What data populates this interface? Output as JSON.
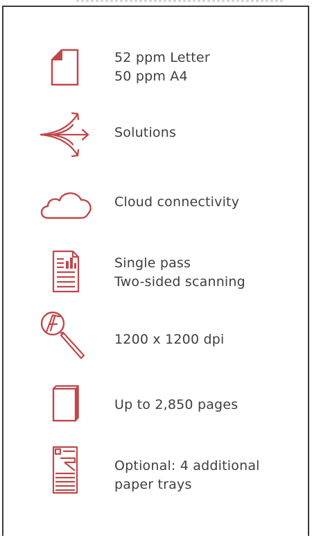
{
  "accent_color": "#c0474a",
  "features": [
    {
      "icon": "page-icon",
      "lines": [
        "52 ppm Letter",
        "50 ppm A4"
      ]
    },
    {
      "icon": "solutions-arrows-icon",
      "lines": [
        "Solutions"
      ]
    },
    {
      "icon": "cloud-icon",
      "lines": [
        "Cloud connectivity"
      ]
    },
    {
      "icon": "scanned-document-icon",
      "lines": [
        "Single pass",
        "Two-sided scanning"
      ]
    },
    {
      "icon": "magnifier-icon",
      "lines": [
        "1200 x 1200 dpi"
      ]
    },
    {
      "icon": "paper-stack-icon",
      "lines": [
        "Up to 2,850 pages"
      ]
    },
    {
      "icon": "printer-trays-icon",
      "lines": [
        "Optional: 4 additional",
        "paper trays"
      ]
    }
  ]
}
